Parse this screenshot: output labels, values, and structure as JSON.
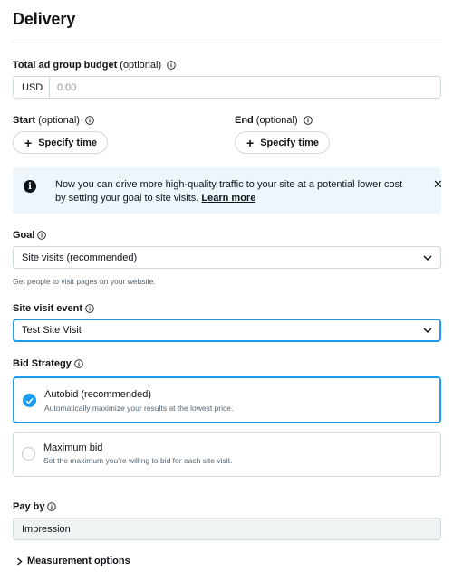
{
  "page": {
    "title": "Delivery"
  },
  "budget": {
    "label": "Total ad group budget",
    "optional": "(optional)",
    "currency": "USD",
    "placeholder": "0.00",
    "value": ""
  },
  "schedule": {
    "start_label": "Start",
    "start_optional": "(optional)",
    "start_button": "Specify time",
    "end_label": "End",
    "end_optional": "(optional)",
    "end_button": "Specify time",
    "plus_glyph": "+"
  },
  "banner": {
    "icon_glyph": "i",
    "text": "Now you can drive more high-quality traffic to your site at a potential lower cost by setting your goal to site visits.",
    "link": "Learn more",
    "close_glyph": "✕"
  },
  "goal": {
    "label": "Goal",
    "value": "Site visits (recommended)",
    "helper": "Get people to visit pages on your website."
  },
  "site_visit_event": {
    "label": "Site visit event",
    "value": "Test Site Visit"
  },
  "bid_strategy": {
    "label": "Bid Strategy",
    "options": [
      {
        "title": "Autobid (recommended)",
        "description": "Automatically maximize your results at the lowest price.",
        "selected": true
      },
      {
        "title": "Maximum bid",
        "description": "Set the maximum you’re willing to bid for each site visit.",
        "selected": false
      }
    ]
  },
  "pay_by": {
    "label": "Pay by",
    "value": "Impression"
  },
  "measurement": {
    "label": "Measurement options"
  },
  "icons": {
    "info": "info-circle-icon",
    "chevron_down": "chevron-down-icon",
    "chevron_right": "chevron-right-icon",
    "check": "check-icon",
    "close": "close-icon",
    "plus": "plus-icon"
  },
  "colors": {
    "accent": "#1d9bf0",
    "text": "#0f1419",
    "muted": "#536471",
    "border": "#cfd9de",
    "banner_bg": "#eef6fb",
    "readonly_bg": "#eff3f4"
  }
}
